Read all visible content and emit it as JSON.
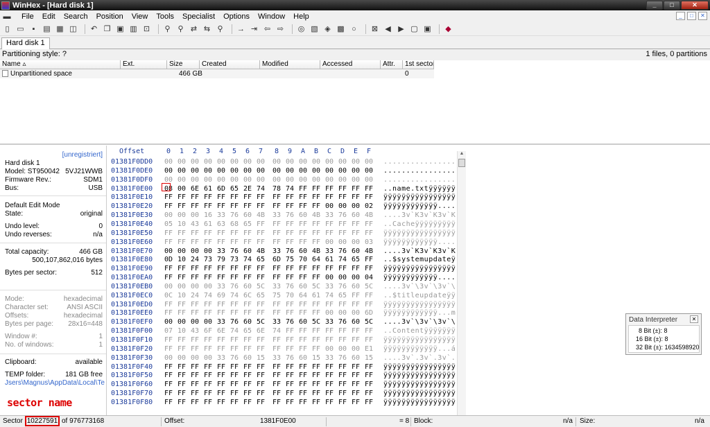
{
  "app": {
    "title": "WinHex - [Hard disk 1]"
  },
  "window_buttons": {
    "minimize": "_",
    "maximize": "□",
    "close": "✕"
  },
  "menu": [
    {
      "label": "File"
    },
    {
      "label": "Edit"
    },
    {
      "label": "Search"
    },
    {
      "label": "Position"
    },
    {
      "label": "View"
    },
    {
      "label": "Tools"
    },
    {
      "label": "Specialist"
    },
    {
      "label": "Options"
    },
    {
      "label": "Window"
    },
    {
      "label": "Help"
    }
  ],
  "toolbar_icons": [
    "new-icon",
    "open-icon",
    "save-icon",
    "print-icon",
    "properties-icon",
    "open-disk-icon",
    "undo-icon",
    "copy-icon",
    "paste-icon",
    "clipboard-icon",
    "write-icon",
    "find-text-icon",
    "find-hex-icon",
    "replace-text-icon",
    "replace-hex-icon",
    "search-combined-icon",
    "goto-offset-icon",
    "goto-sector-icon",
    "back-icon",
    "forward-icon",
    "disk-tools-icon",
    "disk-editor-icon",
    "ram-editor-icon",
    "calculator-icon",
    "search-icon",
    "first-sector-icon",
    "previous-icon",
    "next-icon",
    "snapshot-icon",
    "settings-icon",
    "help-book-icon"
  ],
  "tabs": [
    {
      "label": "Hard disk 1"
    }
  ],
  "partition": {
    "style_label": "Partitioning style: ?",
    "summary": "1 files, 0 partitions"
  },
  "filelist": {
    "columns": [
      "Name",
      "Ext.",
      "Size",
      "Created",
      "Modified",
      "Accessed",
      "Attr.",
      "1st sector"
    ],
    "rows": [
      {
        "name": "Unpartitioned space",
        "ext": "",
        "size": "466 GB",
        "created": "",
        "modified": "",
        "accessed": "",
        "attr": "",
        "first_sector": "0"
      }
    ]
  },
  "info": {
    "unreg": "[unregistriert]",
    "disk": "Hard disk 1",
    "model_label": "Model:",
    "model_val": "ST950042",
    "model_rev": "5VJ21WWB",
    "fw_label": "Firmware Rev.:",
    "fw_val": "SDM1",
    "bus_label": "Bus:",
    "bus_val": "USB",
    "edit_mode": "Default Edit Mode",
    "state_label": "State:",
    "state_val": "original",
    "undo_level_label": "Undo level:",
    "undo_level_val": "0",
    "undo_rev_label": "Undo reverses:",
    "undo_rev_val": "n/a",
    "capacity_label": "Total capacity:",
    "capacity_val": "466 GB",
    "capacity_bytes": "500,107,862,016 bytes",
    "bps_label": "Bytes per sector:",
    "bps_val": "512",
    "mode_label": "Mode:",
    "mode_val": "hexadecimal",
    "charset_label": "Character set:",
    "charset_val": "ANSI ASCII",
    "offsets_label": "Offsets:",
    "offsets_val": "hexadecimal",
    "bpp_label": "Bytes per page:",
    "bpp_val": "28x16=448",
    "window_label": "Window #:",
    "window_val": "1",
    "nwin_label": "No. of windows:",
    "nwin_val": "1",
    "clip_label": "Clipboard:",
    "clip_val": "available",
    "temp_label": "TEMP folder:",
    "temp_val": "181 GB free",
    "temp_path": "Jsers\\Magnus\\AppData\\Local\\Temp"
  },
  "annotation": {
    "text": "sector name"
  },
  "hex": {
    "offset_header": "Offset",
    "columns": [
      "0",
      "1",
      "2",
      "3",
      "4",
      "5",
      "6",
      "7",
      "8",
      "9",
      "A",
      "B",
      "C",
      "D",
      "E",
      "F"
    ],
    "rows": [
      {
        "o": "01381F0DD0",
        "b": "00 00 00 00 00 00 00 00 00 00 00 00 00 00 00 00",
        "a": "................",
        "g": true
      },
      {
        "o": "01381F0DE0",
        "b": "00 00 00 00 00 00 00 00 00 00 00 00 00 00 00 00",
        "a": "................",
        "g": false
      },
      {
        "o": "01381F0DF0",
        "b": "00 00 00 00 00 00 00 00 00 00 00 00 00 00 00 00",
        "a": "................",
        "g": true
      },
      {
        "o": "01381F0E00",
        "b": "08 00 6E 61 6D 65 2E 74 78 74 FF FF FF FF FF FF",
        "a": "..name.txtÿÿÿÿÿÿ",
        "g": false
      },
      {
        "o": "01381F0E10",
        "b": "FF FF FF FF FF FF FF FF FF FF FF FF FF FF FF FF",
        "a": "ÿÿÿÿÿÿÿÿÿÿÿÿÿÿÿÿ",
        "g": false
      },
      {
        "o": "01381F0E20",
        "b": "FF FF FF FF FF FF FF FF FF FF FF FF 00 00 00 02",
        "a": "ÿÿÿÿÿÿÿÿÿÿÿÿ....",
        "g": false
      },
      {
        "o": "01381F0E30",
        "b": "00 00 00 16 33 76 60 4B 33 76 60 4B 33 76 60 4B",
        "a": "....3v`K3v`K3v`K",
        "g": true
      },
      {
        "o": "01381F0E40",
        "b": "05 10 43 61 63 68 65 FF FF FF FF FF FF FF FF FF",
        "a": "..Cacheÿÿÿÿÿÿÿÿÿ",
        "g": true
      },
      {
        "o": "01381F0E50",
        "b": "FF FF FF FF FF FF FF FF FF FF FF FF FF FF FF FF",
        "a": "ÿÿÿÿÿÿÿÿÿÿÿÿÿÿÿÿ",
        "g": true
      },
      {
        "o": "01381F0E60",
        "b": "FF FF FF FF FF FF FF FF FF FF FF FF 00 00 00 03",
        "a": "ÿÿÿÿÿÿÿÿÿÿÿÿ....",
        "g": true
      },
      {
        "o": "01381F0E70",
        "b": "00 00 00 00 33 76 60 4B 33 76 60 4B 33 76 60 4B",
        "a": "....3v`K3v`K3v`K",
        "g": false
      },
      {
        "o": "01381F0E80",
        "b": "0D 10 24 73 79 73 74 65 6D 75 70 64 61 74 65 FF",
        "a": "..$systemupdateÿ",
        "g": false
      },
      {
        "o": "01381F0E90",
        "b": "FF FF FF FF FF FF FF FF FF FF FF FF FF FF FF FF",
        "a": "ÿÿÿÿÿÿÿÿÿÿÿÿÿÿÿÿ",
        "g": false
      },
      {
        "o": "01381F0EA0",
        "b": "FF FF FF FF FF FF FF FF FF FF FF FF 00 00 00 04",
        "a": "ÿÿÿÿÿÿÿÿÿÿÿÿ....",
        "g": false
      },
      {
        "o": "01381F0EB0",
        "b": "00 00 00 00 33 76 60 5C 33 76 60 5C 33 76 60 5C",
        "a": "....3v`\\3v`\\3v`\\",
        "g": true
      },
      {
        "o": "01381F0EC0",
        "b": "0C 10 24 74 69 74 6C 65 75 70 64 61 74 65 FF FF",
        "a": "..$titleupdateÿÿ",
        "g": true
      },
      {
        "o": "01381F0ED0",
        "b": "FF FF FF FF FF FF FF FF FF FF FF FF FF FF FF FF",
        "a": "ÿÿÿÿÿÿÿÿÿÿÿÿÿÿÿÿ",
        "g": true
      },
      {
        "o": "01381F0EE0",
        "b": "FF FF FF FF FF FF FF FF FF FF FF FF 00 00 00 6D",
        "a": "ÿÿÿÿÿÿÿÿÿÿÿÿ...m",
        "g": true
      },
      {
        "o": "01381F0EF0",
        "b": "00 00 00 00 33 76 60 5C 33 76 60 5C 33 76 60 5C",
        "a": "....3v`\\3v`\\3v`\\",
        "g": false
      },
      {
        "o": "01381F0F00",
        "b": "07 10 43 6F 6E 74 65 6E 74 FF FF FF FF FF FF FF",
        "a": "..Contentÿÿÿÿÿÿÿ",
        "g": true
      },
      {
        "o": "01381F0F10",
        "b": "FF FF FF FF FF FF FF FF FF FF FF FF FF FF FF FF",
        "a": "ÿÿÿÿÿÿÿÿÿÿÿÿÿÿÿÿ",
        "g": true
      },
      {
        "o": "01381F0F20",
        "b": "FF FF FF FF FF FF FF FF FF FF FF FF 00 00 00 E1",
        "a": "ÿÿÿÿÿÿÿÿÿÿÿÿ...á",
        "g": true
      },
      {
        "o": "01381F0F30",
        "b": "00 00 00 00 33 76 60 15 33 76 60 15 33 76 60 15",
        "a": "....3v`.3v`.3v`.",
        "g": true
      },
      {
        "o": "01381F0F40",
        "b": "FF FF FF FF FF FF FF FF FF FF FF FF FF FF FF FF",
        "a": "ÿÿÿÿÿÿÿÿÿÿÿÿÿÿÿÿ",
        "g": false
      },
      {
        "o": "01381F0F50",
        "b": "FF FF FF FF FF FF FF FF FF FF FF FF FF FF FF FF",
        "a": "ÿÿÿÿÿÿÿÿÿÿÿÿÿÿÿÿ",
        "g": false
      },
      {
        "o": "01381F0F60",
        "b": "FF FF FF FF FF FF FF FF FF FF FF FF FF FF FF FF",
        "a": "ÿÿÿÿÿÿÿÿÿÿÿÿÿÿÿÿ",
        "g": false
      },
      {
        "o": "01381F0F70",
        "b": "FF FF FF FF FF FF FF FF FF FF FF FF FF FF FF FF",
        "a": "ÿÿÿÿÿÿÿÿÿÿÿÿÿÿÿÿ",
        "g": false
      },
      {
        "o": "01381F0F80",
        "b": "FF FF FF FF FF FF FF FF FF FF FF FF FF FF FF FF",
        "a": "ÿÿÿÿÿÿÿÿÿÿÿÿÿÿÿÿ",
        "g": false
      }
    ]
  },
  "data_interpreter": {
    "title": "Data Interpreter",
    "rows": [
      {
        "label": "8 Bit (±): 8"
      },
      {
        "label": "16 Bit (±): 8"
      },
      {
        "label": "32 Bit (±): 1634598920"
      }
    ]
  },
  "status": {
    "sector_prefix": "Sector",
    "sector_val": "10227591",
    "sector_suffix": "of 976773168",
    "offset_label": "Offset:",
    "offset_val": "1381F0E00",
    "eq_val": "= 8",
    "block_label": "Block:",
    "block_val": "n/a",
    "size_label": "Size:",
    "size_val": "n/a"
  }
}
